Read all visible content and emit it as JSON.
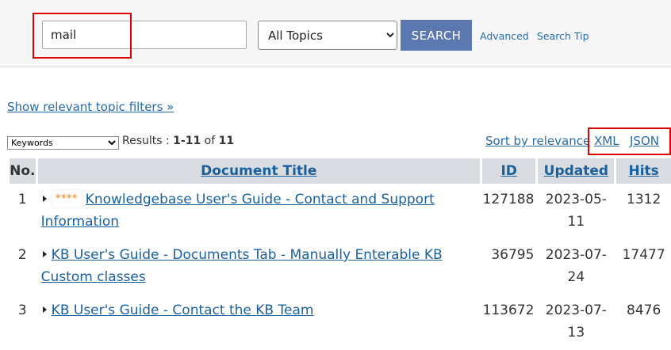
{
  "search": {
    "query": "mail",
    "topic_selected": "All Topics",
    "button_label": "SEARCH",
    "advanced_label": "Advanced",
    "tip_label": "Search Tip"
  },
  "filters_link": "Show relevant topic filters »",
  "results_bar": {
    "keyword_mode": "Keywords",
    "results_prefix": "Results :",
    "range": "1-11",
    "of": "of",
    "total": "11",
    "sort_label": "Sort by relevance",
    "xml_label": "XML",
    "json_label": "JSON"
  },
  "table": {
    "headers": {
      "no": "No.",
      "title": "Document Title",
      "id": "ID",
      "updated": "Updated",
      "hits": "Hits"
    },
    "rows": [
      {
        "no": "1",
        "stars": "****",
        "title": "Knowledgebase User's Guide - Contact and Support Information",
        "id": "127188",
        "updated": "2023-05-11",
        "hits": "1312"
      },
      {
        "no": "2",
        "stars": "",
        "title": "KB User's Guide - Documents Tab - Manually Enterable KB Custom classes",
        "id": "36795",
        "updated": "2023-07-24",
        "hits": "17477"
      },
      {
        "no": "3",
        "stars": "",
        "title": "KB User's Guide - Contact the KB Team",
        "id": "113672",
        "updated": "2023-07-13",
        "hits": "8476"
      }
    ]
  },
  "colors": {
    "link": "#1a5f9e",
    "button": "#5b79b0",
    "highlight": "#e00000",
    "stars": "#e8891a",
    "header_bg": "#d9dde2"
  }
}
